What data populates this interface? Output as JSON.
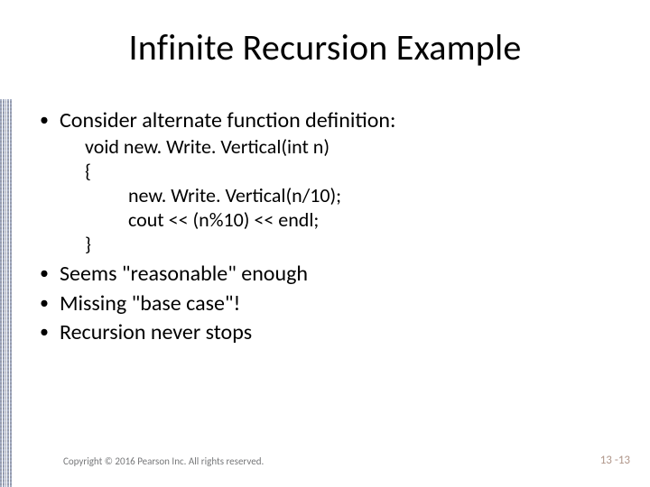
{
  "title": "Infinite Recursion Example",
  "bullets": {
    "b1": "Consider alternate function definition:",
    "b2": "Seems \"reasonable\" enough",
    "b3": "Missing \"base case\"!",
    "b4": "Recursion never stops"
  },
  "code": {
    "l1": "void new. Write. Vertical(int n)",
    "l2": "{",
    "l3": "new. Write. Vertical(n/10);",
    "l4": "cout << (n%10) << endl;",
    "l5": "}"
  },
  "footer": {
    "copyright": "Copyright © 2016 Pearson Inc. All rights reserved.",
    "page": "13 -13"
  }
}
